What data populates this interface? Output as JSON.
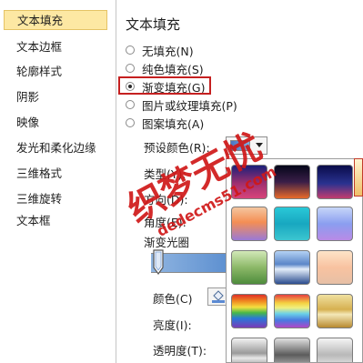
{
  "sidebar": {
    "items": [
      {
        "label": "文本填充",
        "selected": true
      },
      {
        "label": "文本边框",
        "selected": false
      },
      {
        "label": "轮廓样式",
        "selected": false
      },
      {
        "label": "阴影",
        "selected": false
      },
      {
        "label": "映像",
        "selected": false
      },
      {
        "label": "发光和柔化边缘",
        "selected": false
      },
      {
        "label": "三维格式",
        "selected": false
      },
      {
        "label": "三维旋转",
        "selected": false
      },
      {
        "label": "文本框",
        "selected": false
      }
    ]
  },
  "fill": {
    "title": "文本填充",
    "options": [
      {
        "label": "无填充(N)",
        "checked": false
      },
      {
        "label": "纯色填充(S)",
        "checked": false
      },
      {
        "label": "渐变填充(G)",
        "checked": true
      },
      {
        "label": "图片或纹理填充(P)",
        "checked": false
      },
      {
        "label": "图案填充(A)",
        "checked": false
      }
    ]
  },
  "gradient": {
    "preset_label": "预设颜色(R):",
    "type_label": "类型(Y):",
    "direction_label": "方向(D):",
    "angle_label": "角度(E):",
    "stops_label": "渐变光圈",
    "color_label": "颜色(C)",
    "brightness_label": "亮度(I):",
    "transparency_label": "透明度(T):"
  },
  "watermark": {
    "text_main": "织梦无忧",
    "text_url": "dedecms51.com"
  },
  "colors": {
    "selected_bg": "#fde8a3",
    "highlight_red": "#c52020",
    "watermark_red": "#d01818"
  }
}
